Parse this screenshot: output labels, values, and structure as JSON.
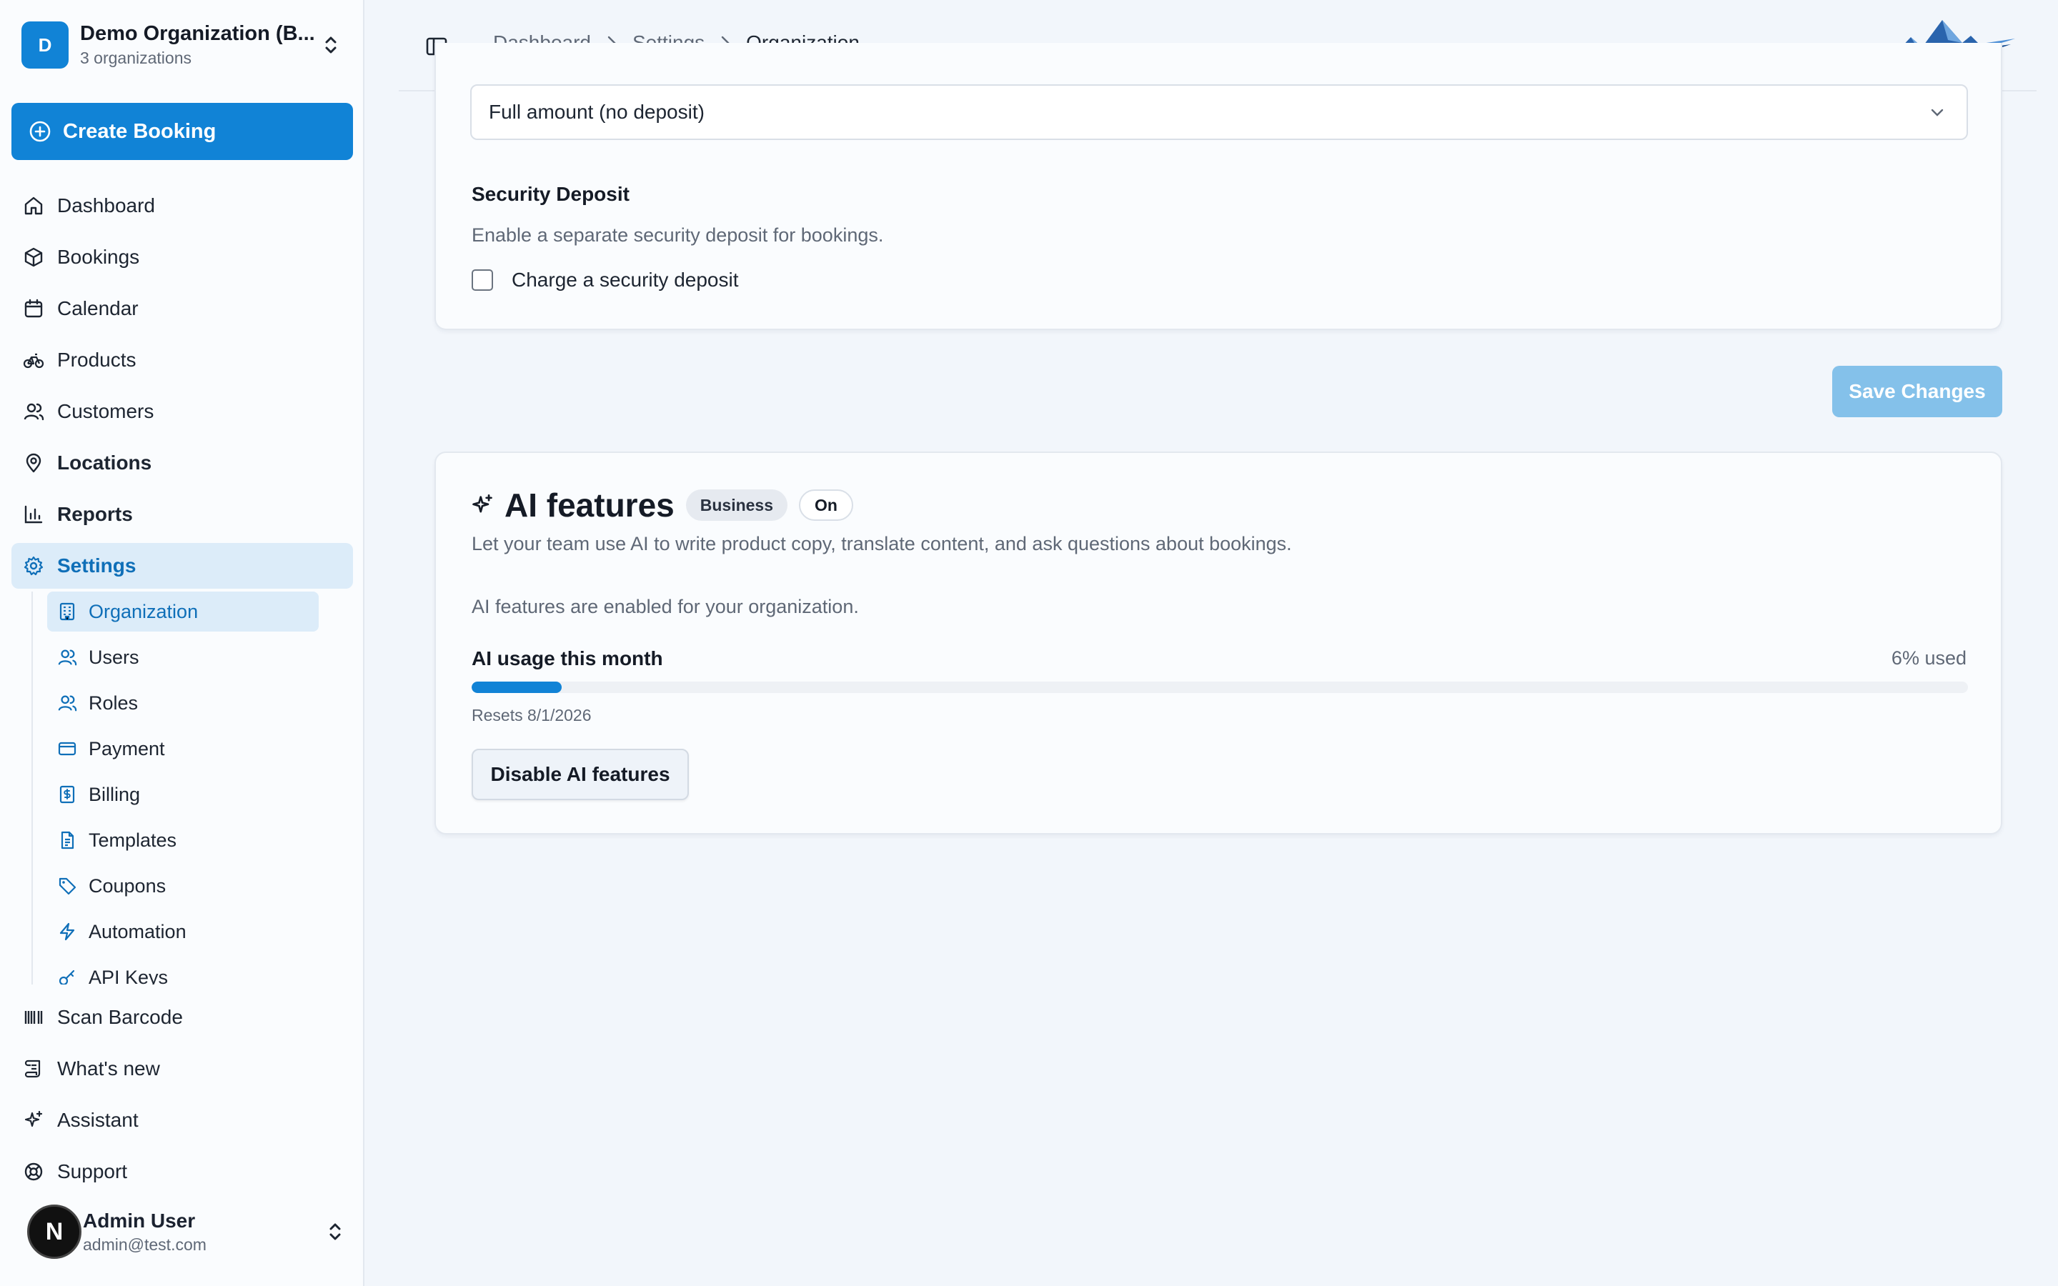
{
  "org": {
    "initial": "D",
    "name": "Demo Organization (B...",
    "count": "3 organizations"
  },
  "sidebar": {
    "create_label": "Create Booking",
    "nav": [
      {
        "label": "Dashboard",
        "icon": "home-icon"
      },
      {
        "label": "Bookings",
        "icon": "box-icon"
      },
      {
        "label": "Calendar",
        "icon": "calendar-icon"
      },
      {
        "label": "Products",
        "icon": "bike-icon"
      },
      {
        "label": "Customers",
        "icon": "users-icon"
      },
      {
        "label": "Locations",
        "icon": "map-pin-icon"
      },
      {
        "label": "Reports",
        "icon": "bar-chart-icon"
      },
      {
        "label": "Settings",
        "icon": "gear-icon"
      }
    ],
    "settings_sub": [
      {
        "label": "Organization",
        "icon": "building-icon"
      },
      {
        "label": "Users",
        "icon": "users-icon"
      },
      {
        "label": "Roles",
        "icon": "users-icon"
      },
      {
        "label": "Payment",
        "icon": "credit-card-icon"
      },
      {
        "label": "Billing",
        "icon": "dollar-receipt-icon"
      },
      {
        "label": "Templates",
        "icon": "file-text-icon"
      },
      {
        "label": "Coupons",
        "icon": "tag-icon"
      },
      {
        "label": "Automation",
        "icon": "bolt-icon"
      },
      {
        "label": "API Keys",
        "icon": "key-icon"
      }
    ],
    "bottom_nav": [
      {
        "label": "Scan Barcode",
        "icon": "barcode-icon"
      },
      {
        "label": "What's new",
        "icon": "scroll-icon"
      },
      {
        "label": "Assistant",
        "icon": "sparkles-icon"
      },
      {
        "label": "Support",
        "icon": "life-buoy-icon"
      }
    ],
    "user": {
      "initial": "N",
      "name": "Admin User",
      "email": "admin@test.com"
    }
  },
  "header": {
    "breadcrumbs": [
      "Dashboard",
      "Settings",
      "Organization"
    ]
  },
  "payment_card": {
    "deposit_select_value": "Full amount (no deposit)",
    "security_title": "Security Deposit",
    "security_desc": "Enable a separate security deposit for bookings.",
    "checkbox_label": "Charge a security deposit",
    "checkbox_checked": false
  },
  "save_label": "Save Changes",
  "ai_card": {
    "title": "AI features",
    "badge_plan": "Business",
    "badge_status": "On",
    "description": "Let your team use AI to write product copy, translate content, and ask questions about bookings.",
    "enabled_text": "AI features are enabled for your organization.",
    "usage_label": "AI usage this month",
    "usage_pct_text": "6% used",
    "usage_fraction": 0.06,
    "resets_text": "Resets 8/1/2026",
    "disable_label": "Disable AI features"
  },
  "colors": {
    "accent": "#1183d6",
    "active_bg": "#dcecf9",
    "save_disabled": "#84c1ea"
  }
}
